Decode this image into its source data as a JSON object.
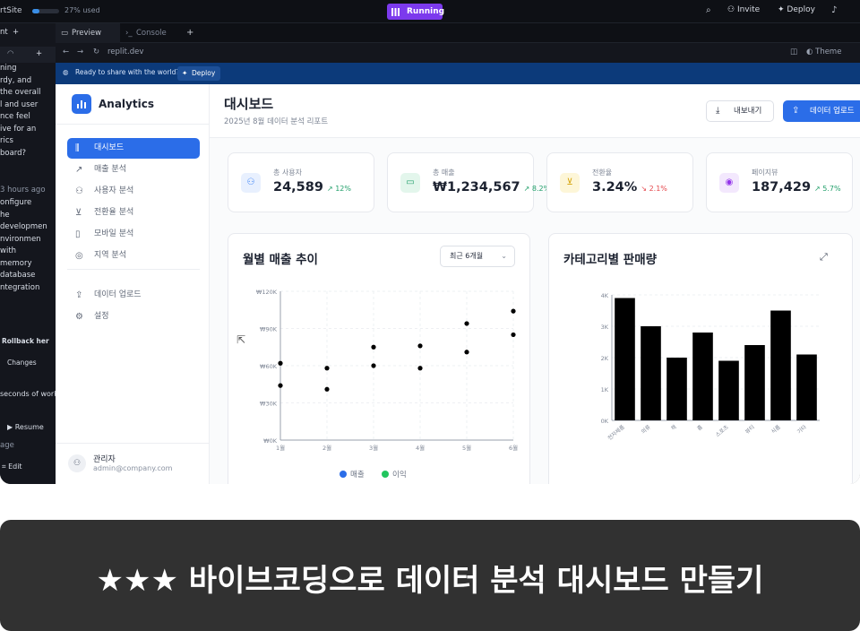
{
  "topbar": {
    "app_name": "rtSite",
    "usage_text": "27% used",
    "usage_fraction": 0.27,
    "run_label": "Running",
    "invite_label": "Invite",
    "deploy_label": "Deploy",
    "icons": [
      "search-icon",
      "invite-icon",
      "rocket-icon",
      "bell-icon"
    ]
  },
  "left_panel": {
    "header": "nt",
    "lines": [
      "ning",
      "rdy, and",
      "the overall",
      "l and user",
      "nce feel",
      "ive for an",
      "rics",
      "board?"
    ],
    "time1": "3 hours ago",
    "lines2": [
      "onfigure",
      "he",
      "developmen",
      "nvironmen",
      "with",
      "memory",
      "database",
      "ntegration"
    ],
    "rollback": "Rollback her",
    "changes": "Changes",
    "time2": "seconds of work",
    "resume": "Resume",
    "age": "age",
    "edit": "Edit"
  },
  "tabs": [
    {
      "label": "Preview",
      "icon": "monitor-icon"
    },
    {
      "label": "Console",
      "icon": "terminal-icon"
    }
  ],
  "url": {
    "text": "replit.dev",
    "theme_label": "Theme"
  },
  "deploy_banner": {
    "text": "Ready to share with the world?",
    "button": "Deploy"
  },
  "app": {
    "brand": "Analytics",
    "nav": [
      {
        "label": "대시보드",
        "icon": "bar-chart-icon",
        "active": true
      },
      {
        "label": "매출 분석",
        "icon": "trend-icon",
        "active": false
      },
      {
        "label": "사용자 분석",
        "icon": "users-icon",
        "active": false
      },
      {
        "label": "전환율 분석",
        "icon": "cart-icon",
        "active": false
      },
      {
        "label": "모바일 분석",
        "icon": "mobile-icon",
        "active": false
      },
      {
        "label": "지역 분석",
        "icon": "globe-icon",
        "active": false
      }
    ],
    "nav2": [
      {
        "label": "데이터 업로드",
        "icon": "upload-icon"
      },
      {
        "label": "설정",
        "icon": "gear-icon"
      }
    ],
    "user": {
      "name": "관리자",
      "email": "admin@company.com"
    },
    "header": {
      "title": "대시보드",
      "subtitle": "2025년 8월 데이터 분석 리포트",
      "export_label": "내보내기",
      "upload_label": "데이터 업로드"
    },
    "kpis": [
      {
        "label": "총 사용자",
        "value": "24,589",
        "change": "12%",
        "direction": "up",
        "icon": "users-icon",
        "color": "#3b82f6",
        "bg": "#e8f0fe"
      },
      {
        "label": "총 매출",
        "value": "₩1,234,567",
        "change": "8.2%",
        "direction": "up",
        "icon": "wallet-icon",
        "color": "#22a06b",
        "bg": "#e3f6ec"
      },
      {
        "label": "전환율",
        "value": "3.24%",
        "change": "2.1%",
        "direction": "down",
        "icon": "cart-icon",
        "color": "#d4a106",
        "bg": "#fdf6d8"
      },
      {
        "label": "페이지뷰",
        "value": "187,429",
        "change": "5.7%",
        "direction": "up",
        "icon": "eye-icon",
        "color": "#9333ea",
        "bg": "#f3e8fd"
      }
    ],
    "colors": {
      "up": "#22a06b",
      "down": "#e5484d",
      "accent": "#2b6de8"
    }
  },
  "chart_data": [
    {
      "type": "scatter",
      "title": "월별 매출 추이",
      "period_select": "최근 6개월",
      "x": [
        "1월",
        "2월",
        "3월",
        "4월",
        "5월",
        "6월"
      ],
      "ylim": [
        0,
        120000
      ],
      "yticks": [
        "₩0K",
        "₩30K",
        "₩60K",
        "₩90K",
        "₩120K"
      ],
      "series": [
        {
          "name": "매출",
          "color": "#2b6de8",
          "values": [
            62000,
            58000,
            75000,
            76000,
            94000,
            104000
          ]
        },
        {
          "name": "이익",
          "color": "#22c55e",
          "values": [
            44000,
            41000,
            60000,
            58000,
            71000,
            85000
          ]
        }
      ],
      "grid": true,
      "legend": "bottom"
    },
    {
      "type": "bar",
      "title": "카테고리별 판매량",
      "categories": [
        "전자제품",
        "의류",
        "책",
        "홈",
        "스포츠",
        "뷰티",
        "식품",
        "기타"
      ],
      "values": [
        3900,
        3000,
        2000,
        2800,
        1900,
        2400,
        3500,
        2100
      ],
      "ylim": [
        0,
        4000
      ],
      "yticks": [
        "0K",
        "1K",
        "2K",
        "3K",
        "4K"
      ],
      "grid": true
    }
  ],
  "caption": "★★★ 바이브코딩으로 데이터 분석 대시보드 만들기"
}
